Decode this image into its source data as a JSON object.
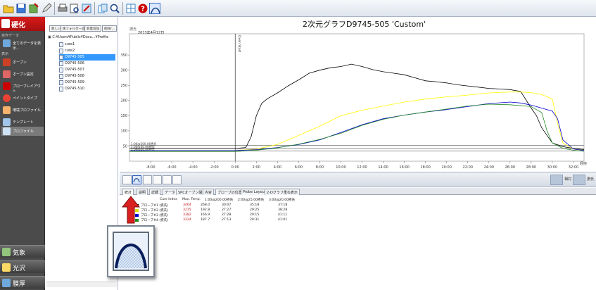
{
  "toolbar": {
    "buttons": [
      "open-folder-icon",
      "save-icon",
      "save-as-icon",
      "pencil-icon",
      "print-icon",
      "print-preview-icon",
      "export-icon",
      "copy-icon",
      "zoom-icon",
      "tile-icon",
      "help-icon",
      "profile-icon"
    ]
  },
  "leftnav": {
    "header": "硬化",
    "caption1": "自作データ",
    "all_data_label": "全てのデータを表示...",
    "caption2": "表示",
    "items": [
      "オーブン",
      "オーブン設定",
      "プローブレイアウト",
      "ペイントタイプ",
      "環境プロファイル",
      "テンプレート",
      "プロファイル"
    ],
    "bottom": [
      "気象",
      "光沢",
      "膜厚"
    ]
  },
  "tree": {
    "buttons": [
      "新しい",
      "後フォルダー追",
      "新着追加",
      "削除/..."
    ],
    "root": "C:¥Users¥Public¥Docu...¥Profile",
    "items": [
      "cure1",
      "cure2",
      "D9745-505",
      "D9745-506",
      "D9745-507",
      "D9745-508",
      "D9745-509",
      "D9745-510"
    ]
  },
  "chart": {
    "title": "2次元グラフD9745-505 'Custom'",
    "date": "2013年4月12日",
    "yunit": "摂氏",
    "xunit": "経時",
    "marker_label": "Oven Start",
    "ref_labels": [
      "1:00@200.00摂氏",
      "1:00@30.00摂氏",
      "1:00@20.00摂氏"
    ]
  },
  "chart_data": {
    "type": "line",
    "title": "2次元グラフD9745-505 'Custom'",
    "xlabel": "経時",
    "ylabel": "摂氏",
    "xlim": [
      -10,
      33
    ],
    "ylim": [
      0,
      420
    ],
    "x_ticks": [
      "-8:00",
      "-6:00",
      "-4:00",
      "-2:00",
      "0:00",
      "2:00",
      "4:00",
      "6:00",
      "8:00",
      "10:00",
      "12:00",
      "14:00",
      "16:00",
      "18:00",
      "20:00",
      "22:00",
      "24:00",
      "26:00",
      "28:00",
      "30:00",
      "32:00"
    ],
    "y_ticks": [
      50,
      100,
      150,
      200,
      250,
      300,
      350
    ],
    "grid": false,
    "series": [
      {
        "name": "プローブ#1",
        "color": "#000000",
        "x": [
          -10,
          0,
          1,
          1.5,
          2,
          2.5,
          3,
          4,
          5,
          6,
          7,
          8,
          9,
          10,
          11,
          12,
          13,
          14,
          15,
          16,
          17,
          18,
          19,
          20,
          21,
          22,
          23,
          24,
          25,
          26,
          27,
          28,
          28.5,
          29,
          30,
          31,
          32,
          33
        ],
        "y": [
          42,
          42,
          45,
          80,
          150,
          190,
          205,
          225,
          248,
          268,
          290,
          300,
          308,
          312,
          320,
          312,
          302,
          295,
          290,
          285,
          275,
          265,
          262,
          258,
          252,
          248,
          244,
          240,
          238,
          236,
          230,
          175,
          150,
          110,
          60,
          48,
          42,
          38
        ]
      },
      {
        "name": "プローブ#2",
        "color": "#ffff00",
        "x": [
          -10,
          0,
          2,
          4,
          6,
          8,
          10,
          12,
          14,
          16,
          18,
          20,
          22,
          24,
          26,
          27,
          28,
          29,
          30,
          30.5,
          31,
          32,
          33
        ],
        "y": [
          35,
          35,
          40,
          55,
          85,
          115,
          150,
          168,
          182,
          195,
          205,
          212,
          218,
          225,
          228,
          228,
          226,
          220,
          205,
          125,
          60,
          40,
          35
        ]
      },
      {
        "name": "プローブ#3",
        "color": "#0000cc",
        "x": [
          -10,
          0,
          2,
          4,
          6,
          8,
          10,
          12,
          14,
          16,
          18,
          20,
          22,
          24,
          26,
          27,
          28,
          29,
          30,
          30.5,
          31,
          32,
          33
        ],
        "y": [
          35,
          35,
          38,
          45,
          55,
          70,
          95,
          120,
          140,
          152,
          162,
          170,
          180,
          190,
          195,
          192,
          185,
          175,
          165,
          140,
          70,
          40,
          35
        ]
      },
      {
        "name": "プローブ#4",
        "color": "#228822",
        "x": [
          -10,
          0,
          2,
          4,
          6,
          8,
          10,
          12,
          14,
          16,
          18,
          20,
          22,
          24,
          26,
          28,
          29,
          29.5,
          30,
          31,
          32,
          33
        ],
        "y": [
          32,
          32,
          36,
          44,
          56,
          72,
          92,
          118,
          138,
          152,
          162,
          172,
          182,
          188,
          186,
          180,
          160,
          100,
          60,
          42,
          36,
          33
        ]
      }
    ],
    "reference_lines": [
      {
        "label": "1:00@200.00摂氏",
        "y": 52
      },
      {
        "label": "1:00@30.00摂氏",
        "y": 42
      },
      {
        "label": "1:00@20.00摂氏",
        "y": 34
      }
    ],
    "vertical_marker": {
      "label": "Oven Start",
      "x": 0
    }
  },
  "chart_tools": {
    "buttons": [
      "bar-chart-icon",
      "profile-icon",
      "histogram-icon",
      "line-chart-icon",
      "pie-icon",
      "table-icon"
    ],
    "toggle1": "相対",
    "toggle2": "摂氏"
  },
  "tabs": [
    "統計",
    "説明",
    "詳細",
    "データ",
    "SPCオーブン開始",
    "内容",
    "プローブの位置",
    "Probe Layout",
    "2-Dグラフ重ね表示"
  ],
  "table": {
    "headers": [
      "Cure Index",
      "Max. Temp.",
      "1:00@200.00摂氏",
      "2:00@25.00摂氏",
      "3:00@20.00摂氏"
    ],
    "rows": [
      {
        "probe": "プローブ#1 (摂氏)",
        "color": "#000000",
        "index": "3464",
        "max": "268.0",
        "c1": "30:07",
        "c2": "35:18",
        "c3": "37:18"
      },
      {
        "probe": "プローブ#2 (摂氏)",
        "color": "#e0e000",
        "index": "3215",
        "max": "192.8",
        "c1": "27:27",
        "c2": "29:25",
        "c3": "38:28"
      },
      {
        "probe": "プローブ#3 (摂氏)",
        "color": "#0000cc",
        "index": "3382",
        "max": "166.9",
        "c1": "27:28",
        "c2": "29:15",
        "c3": "41:11"
      },
      {
        "probe": "プローブ#4 (摂氏)",
        "color": "#228822",
        "index": "3324",
        "max": "187.7",
        "c1": "27:13",
        "c2": "29:31",
        "c3": "41:01"
      }
    ]
  }
}
